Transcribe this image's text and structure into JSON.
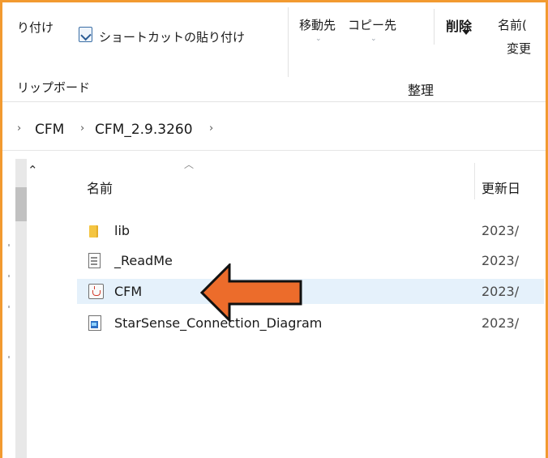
{
  "ribbon": {
    "paste_partial": "り付け",
    "paste_shortcut": "ショートカットの貼り付け",
    "move_to": "移動先",
    "copy_to": "コピー先",
    "delete": "削除",
    "rename_line1": "名前(",
    "rename_line2": "変更",
    "group_clipboard": "リップボード",
    "group_organize": "整理"
  },
  "address": {
    "segments": [
      "CFM",
      "CFM_2.9.3260"
    ]
  },
  "columns": {
    "name": "名前",
    "date": "更新日"
  },
  "files": [
    {
      "name": "lib",
      "icon": "folder-icon",
      "date": "2023/"
    },
    {
      "name": "_ReadMe",
      "icon": "text-file-icon",
      "date": "2023/"
    },
    {
      "name": "CFM",
      "icon": "java-file-icon",
      "date": "2023/"
    },
    {
      "name": "StarSense_Connection_Diagram",
      "icon": "image-file-icon",
      "date": "2023/"
    }
  ],
  "colors": {
    "frame": "#f29a30",
    "arrow_fill": "#ec6c2b",
    "selection": "#e5f1fb"
  }
}
